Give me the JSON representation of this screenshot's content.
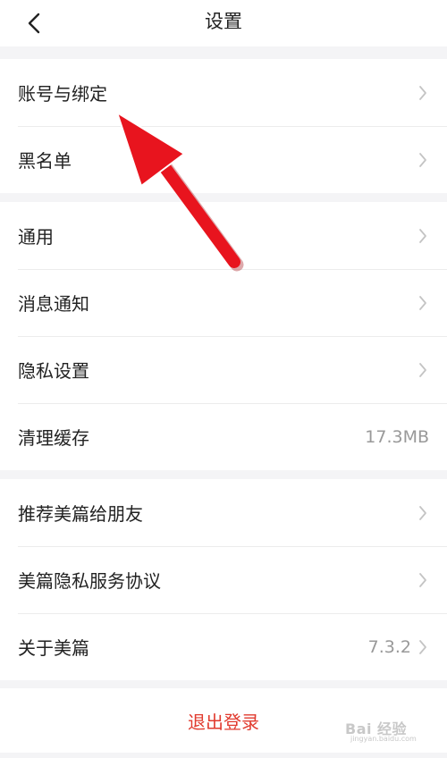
{
  "header": {
    "title": "设置",
    "back_icon": "chevron-left-icon"
  },
  "groups": [
    {
      "items": [
        {
          "label": "账号与绑定",
          "value": ""
        },
        {
          "label": "黑名单",
          "value": ""
        }
      ]
    },
    {
      "items": [
        {
          "label": "通用",
          "value": ""
        },
        {
          "label": "消息通知",
          "value": ""
        },
        {
          "label": "隐私设置",
          "value": ""
        },
        {
          "label": "清理缓存",
          "value": "17.3MB"
        }
      ]
    },
    {
      "items": [
        {
          "label": "推荐美篇给朋友",
          "value": ""
        },
        {
          "label": "美篇隐私服务协议",
          "value": ""
        },
        {
          "label": "关于美篇",
          "value": "7.3.2"
        }
      ]
    }
  ],
  "logout": {
    "label": "退出登录"
  },
  "colors": {
    "accent": "#e13a2e",
    "annotation_arrow": "#e8141e",
    "background": "#f4f4f6"
  },
  "watermark": {
    "logo": "Bai 经验",
    "sub": "jingyan.baidu.com"
  }
}
